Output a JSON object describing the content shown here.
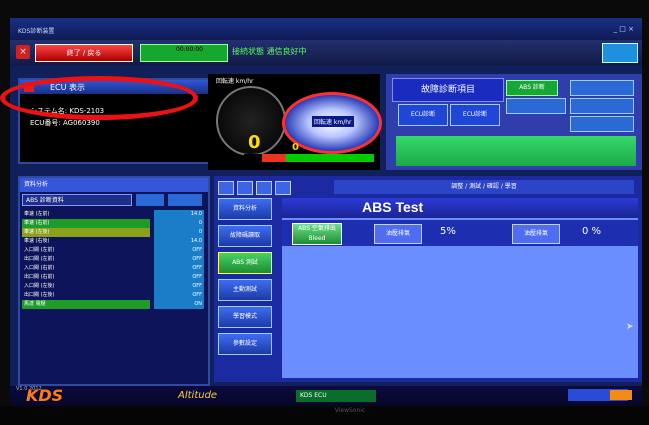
{
  "titlebar": {
    "title": "KDS診断装置",
    "controls": "_ □ ×"
  },
  "toolbar": {
    "close_glyph": "×",
    "red_button": "終了 / 戻る",
    "time": "00:00:00",
    "status": "接続状態 通信良好中",
    "blue_button": ""
  },
  "ecu": {
    "title": "ECU 表示",
    "line1": "システム名: KDS-2103",
    "line2": "ECU番号: AG060390"
  },
  "gauges": {
    "rpm_label": "回転速 km/hr",
    "rpm_value": "0",
    "speed_label": "回転速 km/hr",
    "zero": "0"
  },
  "diag": {
    "title": "故障診断項目",
    "sub1": "ECU診断",
    "sub2": "ECU診断",
    "green": "ABS 診断"
  },
  "left_list": {
    "header": "資料分析",
    "combo": "ABS 診断資料",
    "rows": [
      {
        "label": "車速 (左前)",
        "value": "14.0",
        "style": "n"
      },
      {
        "label": "車速 (右前)",
        "value": "0",
        "style": "g"
      },
      {
        "label": "車速 (左後)",
        "value": "0",
        "style": "y"
      },
      {
        "label": "車速 (右後)",
        "value": "14.0",
        "style": "n"
      },
      {
        "label": "入口閥 (左前)",
        "value": "OFF",
        "style": "n"
      },
      {
        "label": "出口閥 (左前)",
        "value": "OFF",
        "style": "n"
      },
      {
        "label": "入口閥 (右前)",
        "value": "OFF",
        "style": "n"
      },
      {
        "label": "出口閥 (右前)",
        "value": "OFF",
        "style": "n"
      },
      {
        "label": "入口閥 (左後)",
        "value": "OFF",
        "style": "n"
      },
      {
        "label": "出口閥 (左後)",
        "value": "OFF",
        "style": "n"
      },
      {
        "label": "馬達 電壓",
        "value": "ON",
        "style": "g"
      }
    ]
  },
  "main": {
    "title": "調整 / 測試 / 確認 / 學習",
    "side_buttons": [
      "資料分析",
      "故障碼讀取",
      "ABS 測試",
      "主動測試",
      "學習模式",
      "參數設定"
    ],
    "abs_title": "ABS Test",
    "bleed_label": "ABS 空氣排出 Bleed",
    "left_label": "油壓排氣",
    "left_pct": "5%",
    "right_label": "油壓排氣",
    "right_pct": "0 %"
  },
  "statusbar": {
    "kds": "KDS",
    "alt": "Altitude",
    "ecu": "KDS ECU",
    "ver": "V1.0 2012"
  },
  "bezel": {
    "brand": "ViewSonic"
  }
}
